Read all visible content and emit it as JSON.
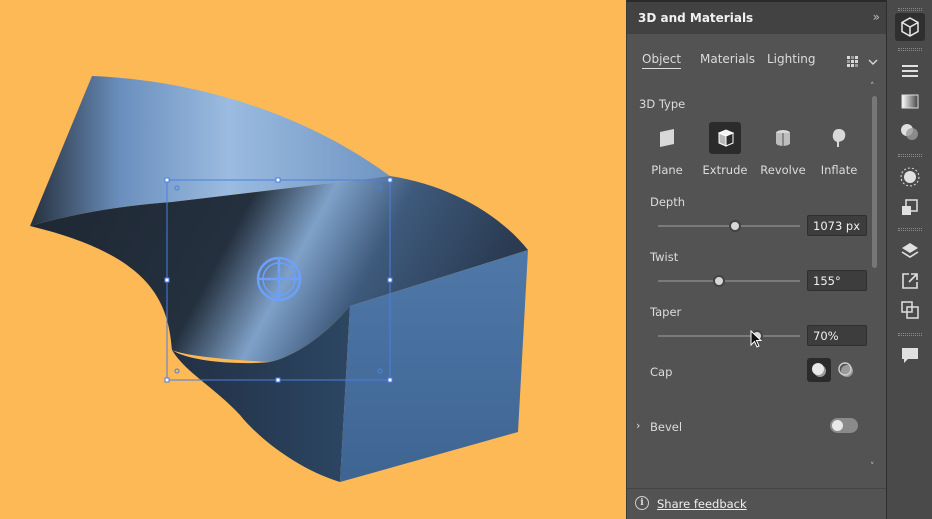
{
  "panel": {
    "title": "3D and Materials",
    "collapse_icon": "double-chevron-right",
    "tabs": [
      {
        "label": "Object",
        "active": true
      },
      {
        "label": "Materials",
        "active": false
      },
      {
        "label": "Lighting",
        "active": false
      }
    ],
    "render_icon": "render-options-icon",
    "type_section_label": "3D Type",
    "types": [
      {
        "label": "Plane",
        "icon": "plane-icon",
        "active": false
      },
      {
        "label": "Extrude",
        "icon": "extrude-icon",
        "active": true
      },
      {
        "label": "Revolve",
        "icon": "revolve-icon",
        "active": false
      },
      {
        "label": "Inflate",
        "icon": "inflate-icon",
        "active": false
      }
    ],
    "depth": {
      "label": "Depth",
      "value": "1073 px",
      "slider_fraction": 0.54
    },
    "twist": {
      "label": "Twist",
      "value": "155°",
      "slider_fraction": 0.43
    },
    "taper": {
      "label": "Taper",
      "value": "70%",
      "slider_fraction": 0.7
    },
    "cap": {
      "label": "Cap",
      "selected": "cap-on"
    },
    "bevel": {
      "label": "Bevel",
      "enabled": false
    },
    "footer": {
      "link": "Share feedback",
      "icon": "info-icon"
    }
  },
  "toolbar": {
    "icons": [
      "3d-cube-icon",
      "menu-lines-icon",
      "gradient-icon",
      "transparency-icon",
      "appearance-sun-icon",
      "image-trace-icon",
      "layers-icon",
      "export-icon",
      "artboards-icon",
      "comments-icon"
    ],
    "active": "3d-cube-icon"
  },
  "colors": {
    "canvas": "#fcb956",
    "object_light": "#8fb3d9",
    "object_dark": "#1f2937",
    "selection": "#4a7fe0",
    "panel_bg": "#535353"
  }
}
